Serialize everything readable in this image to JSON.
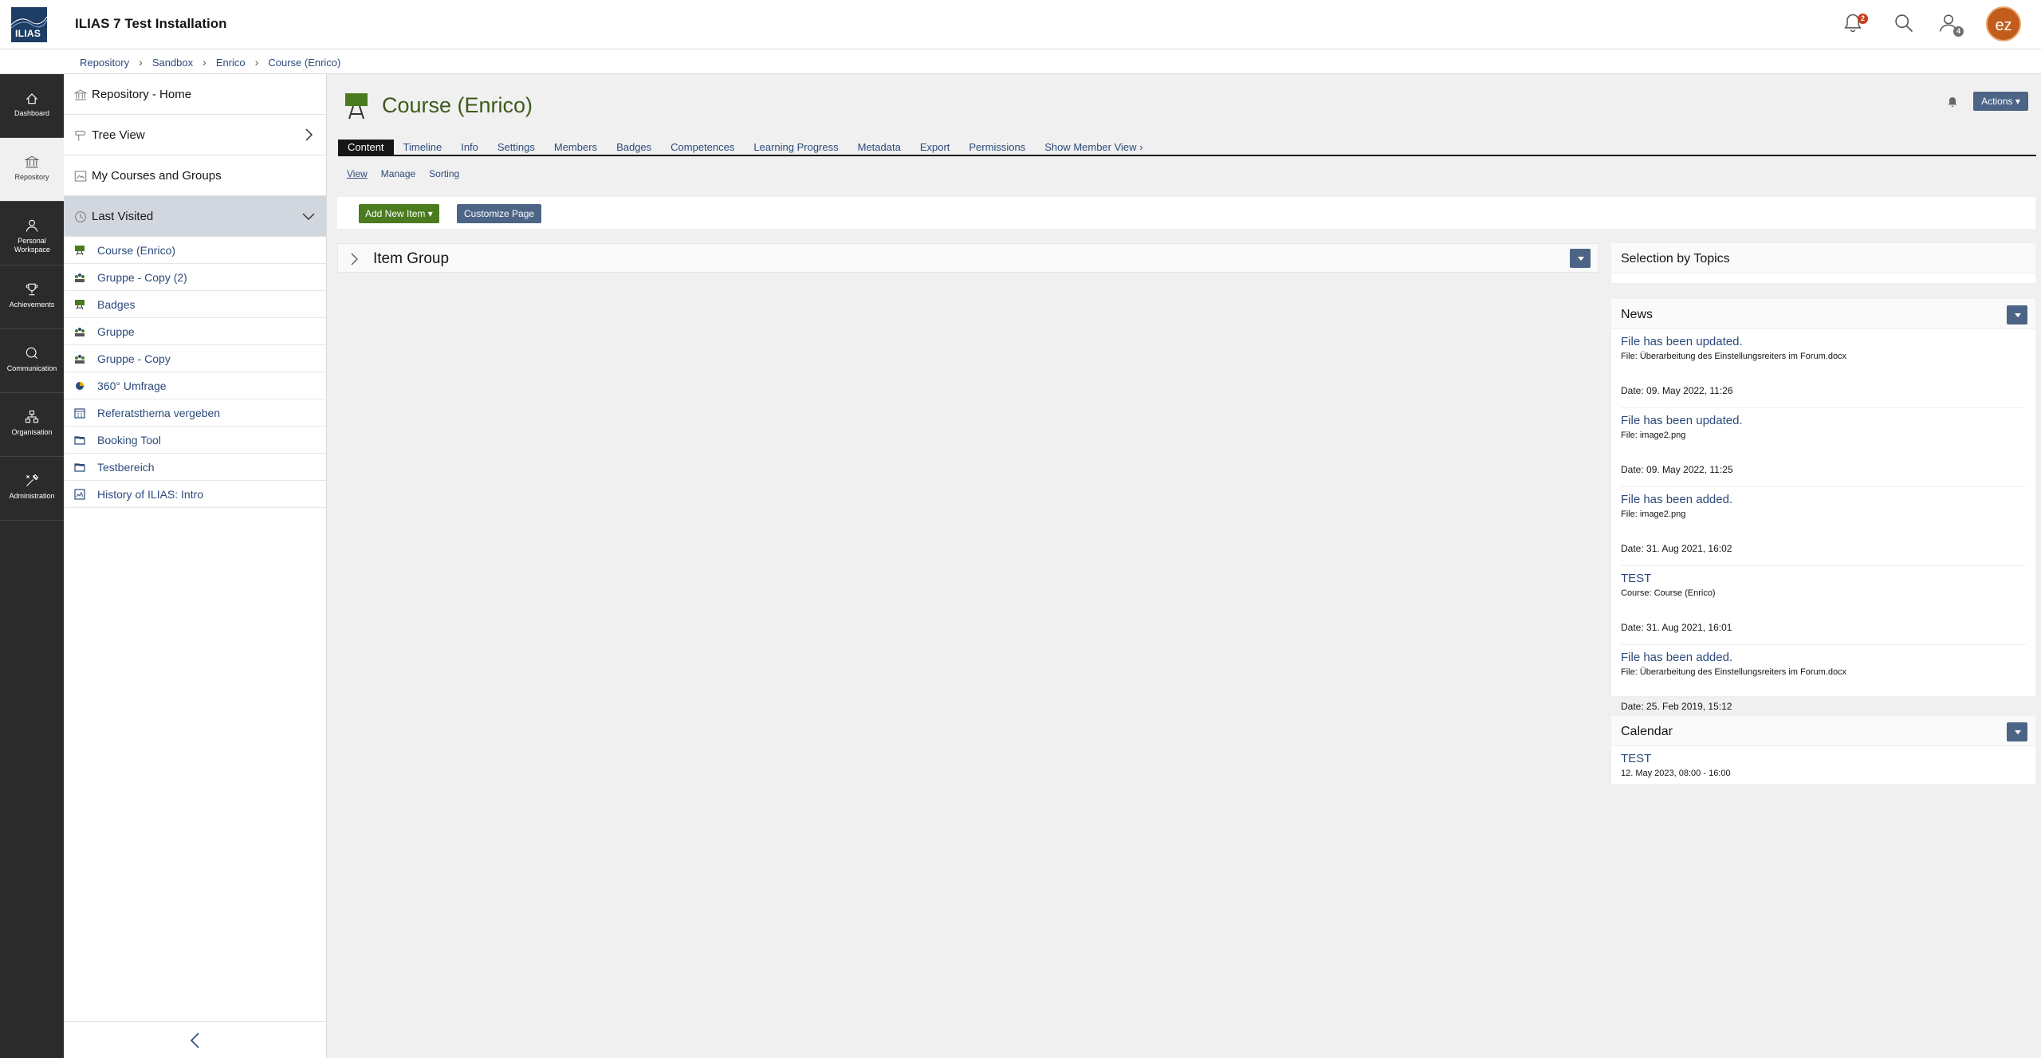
{
  "header": {
    "logo_text": "ILIAS",
    "title": "ILIAS 7 Test Installation",
    "notification_count": "2",
    "user_count": "4",
    "avatar_initials": "ez"
  },
  "breadcrumb": [
    "Repository",
    "Sandbox",
    "Enrico",
    "Course (Enrico)"
  ],
  "mainbar": [
    {
      "label": "Dashboard",
      "icon": "dashboard-icon"
    },
    {
      "label": "Repository",
      "icon": "repository-icon"
    },
    {
      "label": "Personal Workspace",
      "icon": "person-icon"
    },
    {
      "label": "Achievements",
      "icon": "trophy-icon"
    },
    {
      "label": "Communication",
      "icon": "chat-icon"
    },
    {
      "label": "Organisation",
      "icon": "org-icon"
    },
    {
      "label": "Administration",
      "icon": "tools-icon"
    }
  ],
  "slate": {
    "rows": [
      {
        "label": "Repository - Home",
        "icon": "home-building-icon"
      },
      {
        "label": "Tree View",
        "icon": "tree-icon"
      },
      {
        "label": "My Courses and Groups",
        "icon": "courses-icon"
      },
      {
        "label": "Last Visited",
        "icon": "clock-icon"
      }
    ],
    "last_visited": [
      {
        "label": "Course (Enrico)",
        "icon": "course-icon"
      },
      {
        "label": "Gruppe - Copy (2)",
        "icon": "group-icon"
      },
      {
        "label": "Badges",
        "icon": "course-icon"
      },
      {
        "label": "Gruppe",
        "icon": "group-icon"
      },
      {
        "label": "Gruppe - Copy",
        "icon": "group-icon"
      },
      {
        "label": "360° Umfrage",
        "icon": "survey-icon"
      },
      {
        "label": "Referatsthema vergeben",
        "icon": "calendar-icon"
      },
      {
        "label": "Booking Tool",
        "icon": "folder-icon"
      },
      {
        "label": "Testbereich",
        "icon": "folder-icon"
      },
      {
        "label": "History of ILIAS: Intro",
        "icon": "learning-module-icon"
      }
    ]
  },
  "content": {
    "title": "Course (Enrico)",
    "actions_label": "Actions",
    "tabs": [
      "Content",
      "Timeline",
      "Info",
      "Settings",
      "Members",
      "Badges",
      "Competences",
      "Learning Progress",
      "Metadata",
      "Export",
      "Permissions",
      "Show Member View"
    ],
    "subtabs": [
      "View",
      "Manage",
      "Sorting"
    ],
    "add_new_item": "Add New Item",
    "customize_page": "Customize Page",
    "item_group": "Item Group"
  },
  "panels": {
    "topics_title": "Selection by Topics",
    "news_title": "News",
    "news": [
      {
        "title": "File has been updated.",
        "sub": "File: Überarbeitung des Einstellungsreiters im Forum.docx",
        "date": "Date: 09. May 2022, 11:26"
      },
      {
        "title": "File has been updated.",
        "sub": "File: image2.png",
        "date": "Date: 09. May 2022, 11:25"
      },
      {
        "title": "File has been added.",
        "sub": "File: image2.png",
        "date": "Date: 31. Aug 2021, 16:02"
      },
      {
        "title": "TEST",
        "sub": "Course: Course (Enrico)",
        "date": "Date: 31. Aug 2021, 16:01"
      },
      {
        "title": "File has been added.",
        "sub": "File: Überarbeitung des Einstellungsreiters im Forum.docx",
        "date": "Date: 25. Feb 2019, 15:12"
      }
    ],
    "calendar_title": "Calendar",
    "calendar_event": {
      "title": "TEST",
      "time": "12. May 2023, 08:00 - 16:00"
    }
  },
  "colors": {
    "accent": "#4c6586",
    "course_title": "#3d5a1a",
    "add_button": "#4a7b1e",
    "mainbar": "#2b2b2b",
    "link": "#2c4a7c"
  }
}
